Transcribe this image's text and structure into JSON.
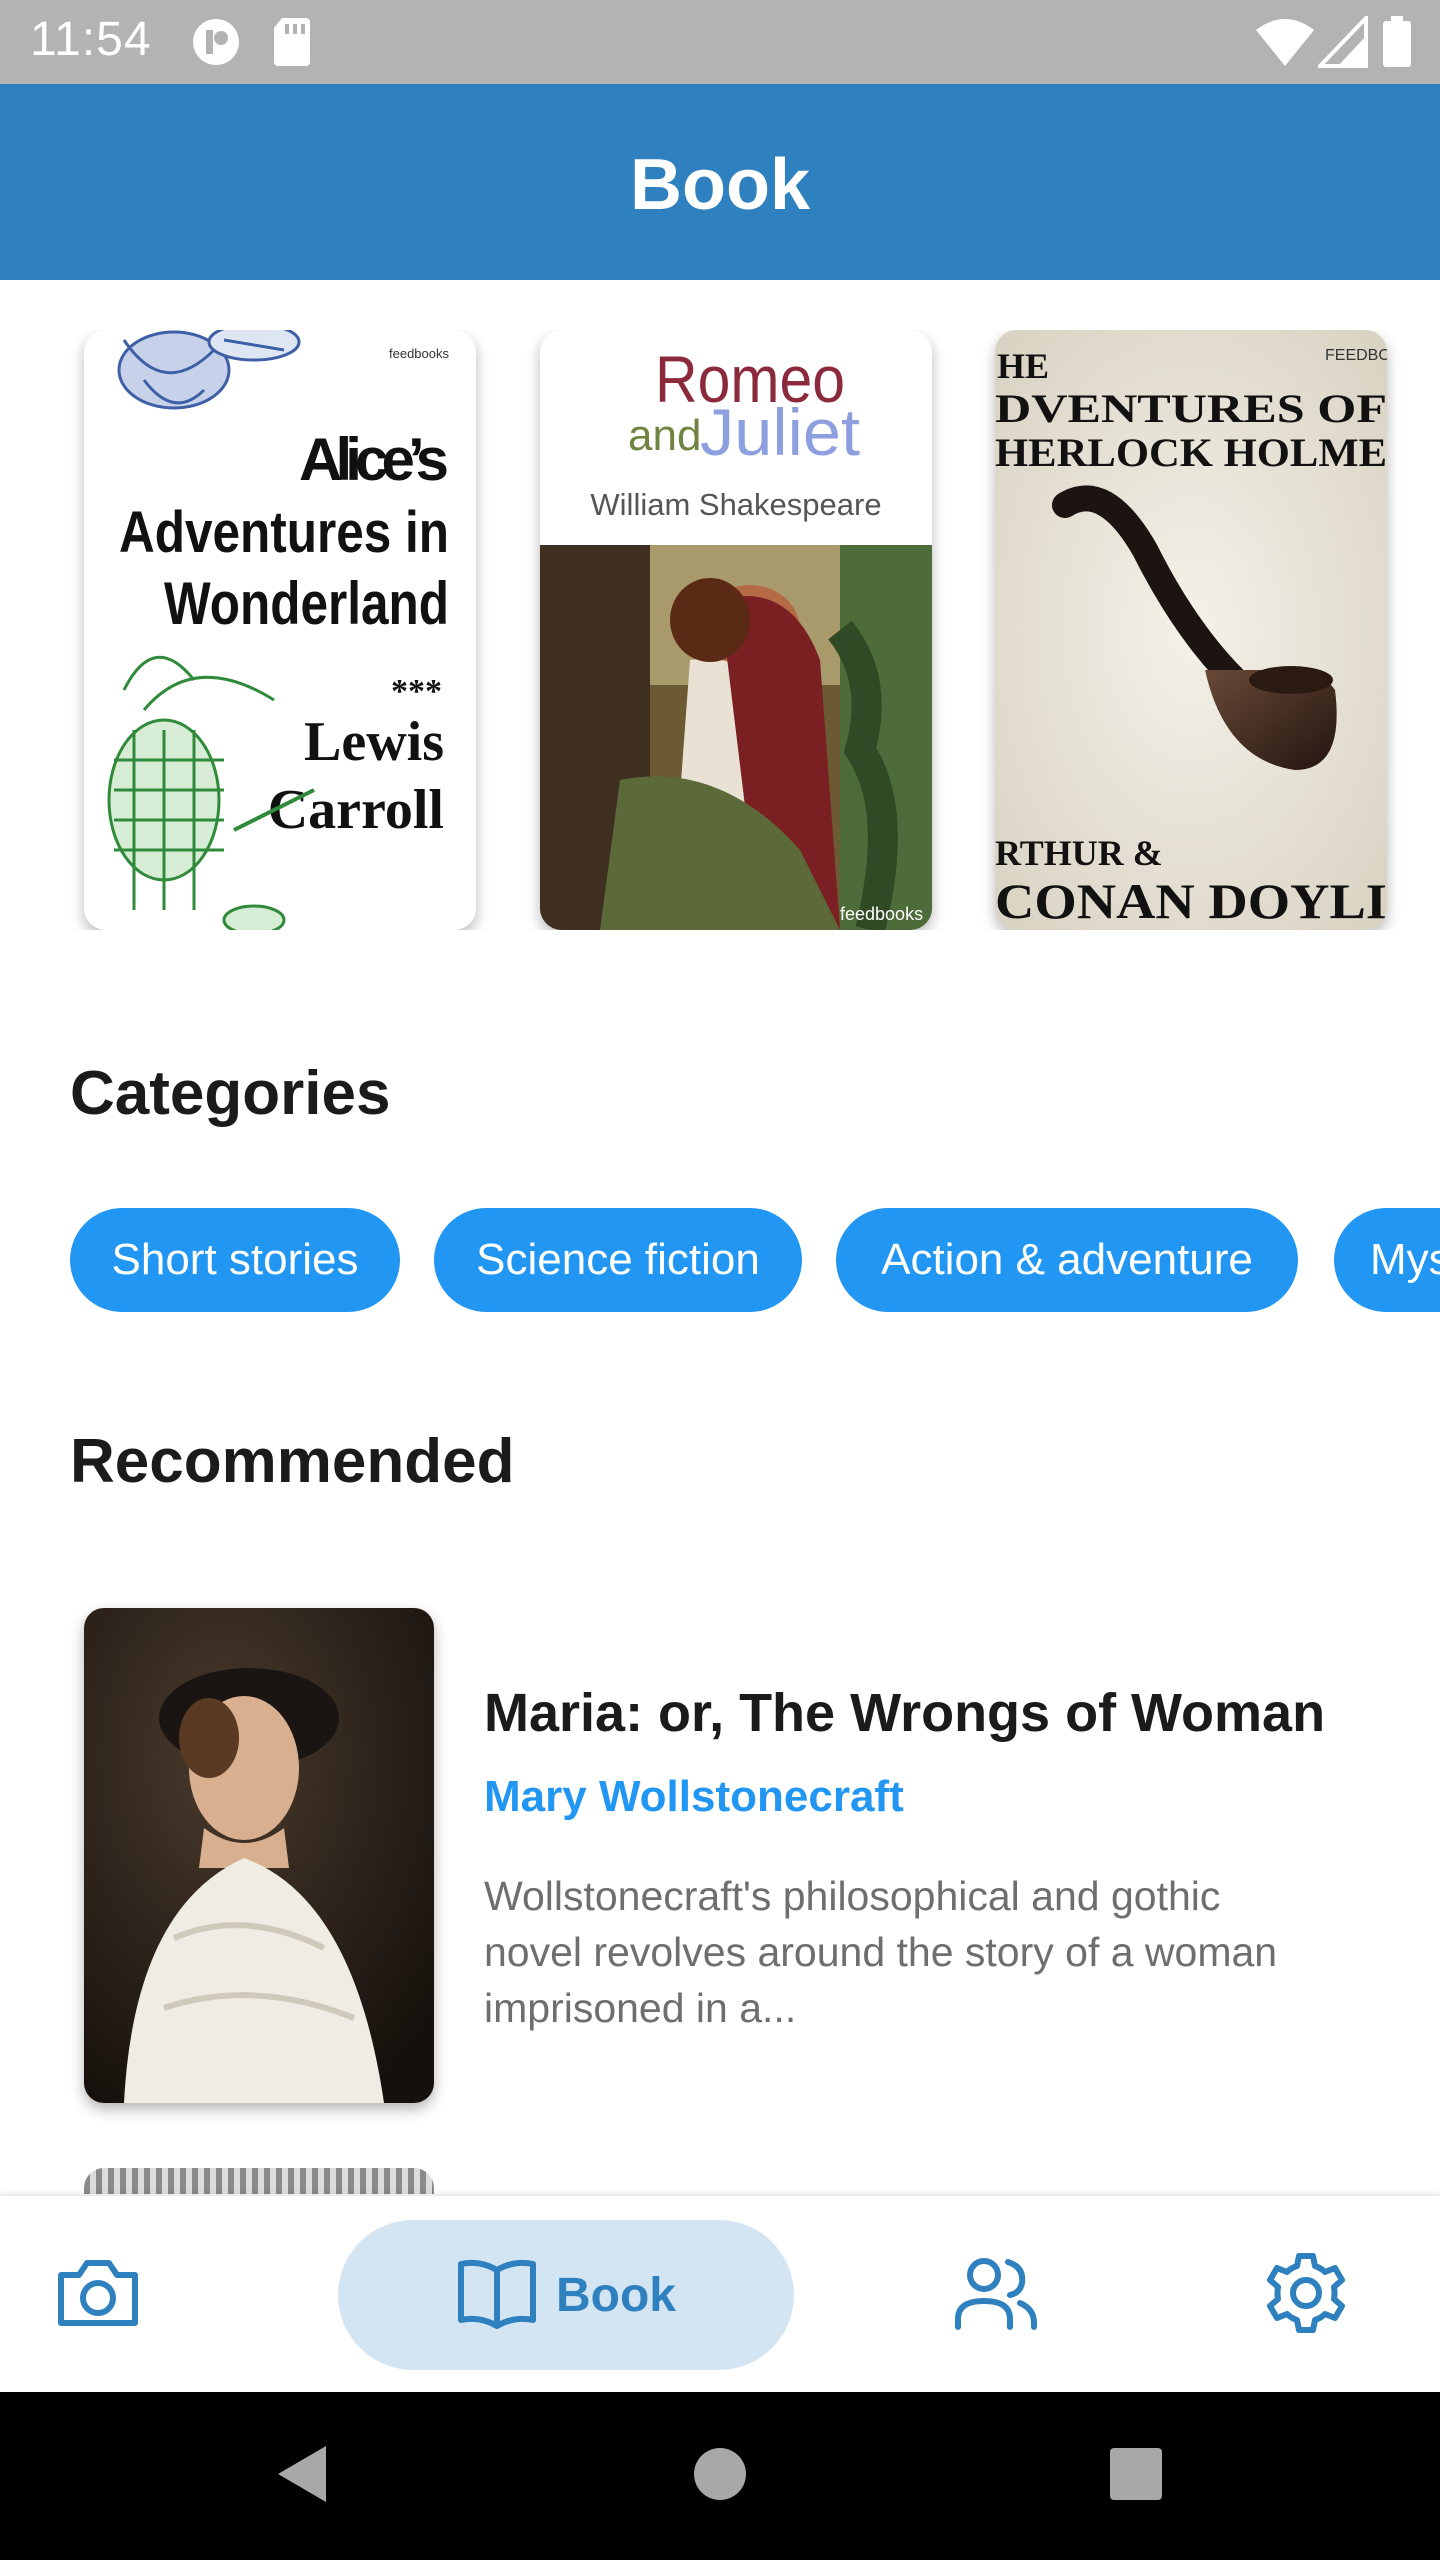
{
  "status_bar": {
    "time": "11:54",
    "icons": [
      "media-icon",
      "sd-card-icon",
      "wifi-icon",
      "signal-icon",
      "battery-icon"
    ]
  },
  "app_bar": {
    "title": "Book"
  },
  "featured_books": [
    {
      "title_lines": [
        "Alice’s",
        "Adventures in",
        "Wonderland"
      ],
      "separator": "***",
      "author_lines": [
        "Lewis",
        "Carroll"
      ],
      "publisher": "feedbooks"
    },
    {
      "title_top": "Romeo",
      "title_and": "and",
      "title_bottom": "Juliet",
      "author": "William Shakespeare",
      "publisher": "feedbooks"
    },
    {
      "title_lines": [
        "HE",
        "DVENTURES OF",
        "HERLOCK HOLME"
      ],
      "author_lines": [
        "RTHUR &",
        "CONAN DOYLI"
      ],
      "publisher": "FEEDBOOKS"
    }
  ],
  "categories": {
    "title": "Categories",
    "chips": [
      "Short stories",
      "Science fiction",
      "Action & adventure",
      "Mys"
    ]
  },
  "recommended": {
    "title": "Recommended",
    "items": [
      {
        "title": "Maria: or, The Wrongs of Woman",
        "author": "Mary Wollstonecraft",
        "description": "Wollstonecraft's philosophical and gothic novel revolves around the story of a woman imprisoned in a..."
      }
    ]
  },
  "bottom_nav": {
    "items": [
      {
        "icon": "camera-icon",
        "label": ""
      },
      {
        "icon": "book-icon",
        "label": "Book",
        "selected": true
      },
      {
        "icon": "people-icon",
        "label": ""
      },
      {
        "icon": "settings-icon",
        "label": ""
      }
    ]
  },
  "colors": {
    "app_bar": "#2f80bf",
    "chip": "#2196f3",
    "author": "#2196f3",
    "nav_pill": "#d3e4f2",
    "status_bar": "#b3b3b3"
  }
}
